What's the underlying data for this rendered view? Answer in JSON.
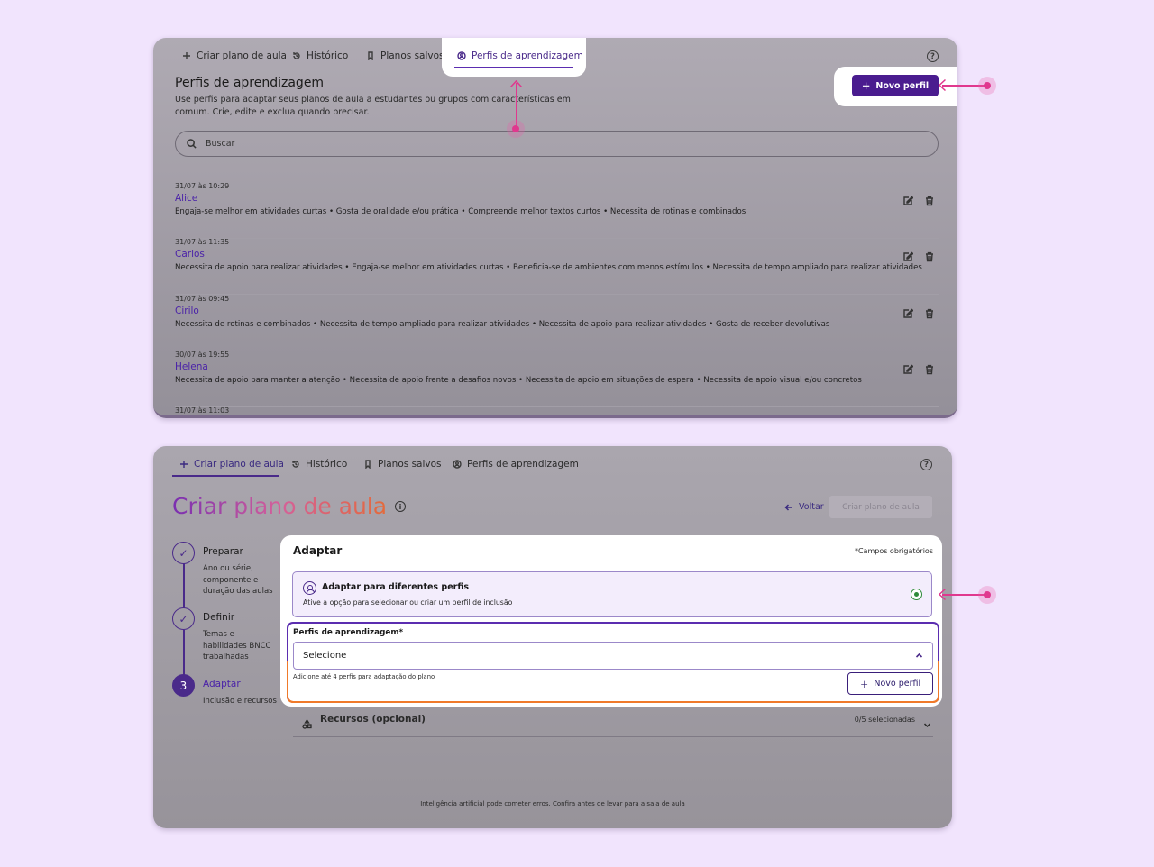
{
  "tabs": {
    "create": "Criar plano de aula",
    "history": "Histórico",
    "saved": "Planos salvos",
    "profiles": "Perfis de aprendizagem"
  },
  "help_icon": "?",
  "profiles_page": {
    "title": "Perfis de aprendizagem",
    "description": "Use perfis para adaptar seus planos de aula a estudantes ou grupos com características em comum. Crie, edite e exclua quando precisar.",
    "new_profile_label": "Novo perfil",
    "search_placeholder": "Buscar",
    "rows": [
      {
        "date": "31/07 às 10:29",
        "name": "Alice",
        "traits": "Engaja-se melhor em atividades curtas • Gosta de oralidade e/ou prática • Compreende melhor textos curtos • Necessita de rotinas e combinados"
      },
      {
        "date": "31/07 às 11:35",
        "name": "Carlos",
        "traits": "Necessita de apoio para realizar atividades • Engaja-se melhor em atividades curtas • Beneficia-se de ambientes com menos estímulos • Necessita de tempo ampliado para realizar atividades"
      },
      {
        "date": "31/07 às 09:45",
        "name": "Cirilo",
        "traits": "Necessita de rotinas e combinados • Necessita de tempo ampliado para realizar atividades • Necessita de apoio para realizar atividades • Gosta de receber devolutivas"
      },
      {
        "date": "30/07 às 19:55",
        "name": "Helena",
        "traits": "Necessita de apoio para manter a atenção • Necessita de apoio frente a desafios novos • Necessita de apoio em situações de espera • Necessita de apoio visual e/ou concretos"
      },
      {
        "date": "31/07 às 11:03",
        "name": "",
        "traits": ""
      }
    ]
  },
  "create_page": {
    "title": "Criar plano de aula",
    "info_icon": "i",
    "back_label": "Voltar",
    "create_label": "Criar plano de aula",
    "steps": [
      {
        "label": "Preparar",
        "sub": "Ano ou série, componente e duração das aulas"
      },
      {
        "label": "Definir",
        "sub": "Temas e habilidades BNCC trabalhadas"
      },
      {
        "label": "Adaptar",
        "number": "3",
        "sub": "Inclusão e recursos"
      }
    ],
    "adapt": {
      "title": "Adaptar",
      "required_note": "*Campos obrigatórios",
      "toggle_title": "Adaptar para diferentes perfis",
      "toggle_desc": "Ative a opção para selecionar ou criar um perfil de inclusão",
      "profiles_label": "Perfis de aprendizagem*",
      "select_value": "Selecione",
      "profiles_help": "Adicione até 4 perfis para adaptação do plano",
      "new_profile_label": "Novo perfil"
    },
    "resources": {
      "label": "Recursos (opcional)",
      "count": "0/5 selecionadas"
    },
    "disclaimer": "Inteligência artificial pode cometer erros. Confira antes de levar para a sala de aula"
  },
  "colors": {
    "accent": "#4a1c8f",
    "link": "#4a22a8",
    "callout": "#e0388e",
    "success": "#2f8a3a",
    "warning_outline": "#f07a2a",
    "background": "#f1e4fd"
  }
}
